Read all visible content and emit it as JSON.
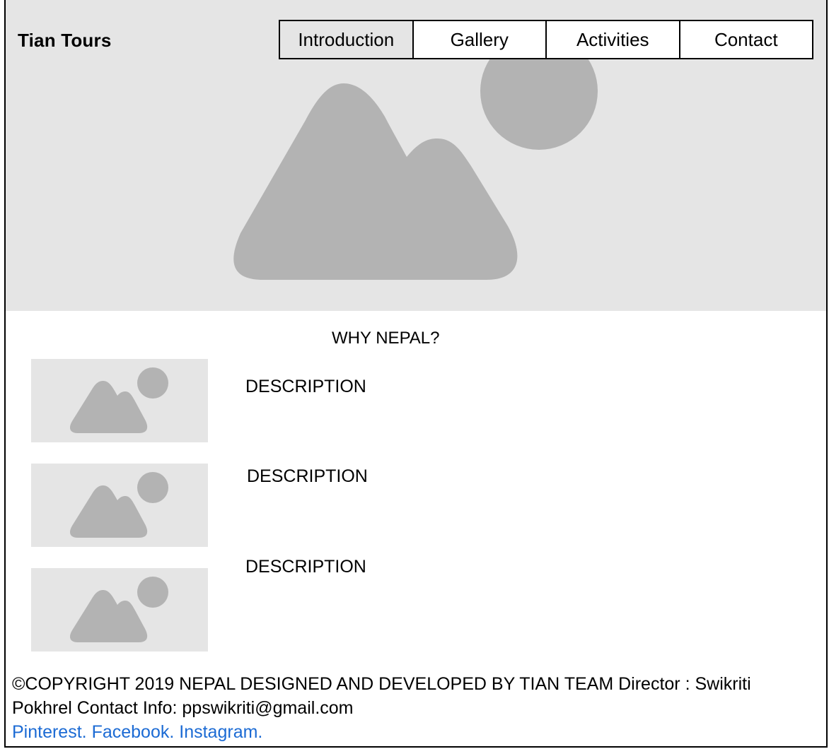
{
  "header": {
    "brand": "Tian Tours",
    "nav": [
      {
        "label": "Introduction",
        "active": true
      },
      {
        "label": "Gallery",
        "active": false
      },
      {
        "label": "Activities",
        "active": false
      },
      {
        "label": "Contact",
        "active": false
      }
    ],
    "hero_image_icon": "image-placeholder-icon"
  },
  "main": {
    "section_title": "WHY NEPAL?",
    "features": [
      {
        "description": "DESCRIPTION",
        "image_icon": "image-placeholder-icon"
      },
      {
        "description": "DESCRIPTION",
        "image_icon": "image-placeholder-icon"
      },
      {
        "description": "DESCRIPTION",
        "image_icon": "image-placeholder-icon"
      }
    ]
  },
  "footer": {
    "copyright": "©COPYRIGHT 2019 NEPAL DESIGNED AND DEVELOPED BY TIAN TEAM Director : Swikriti Pokhrel Contact Info: ppswikriti@gmail.com",
    "links": [
      "Pinterest.",
      "Facebook.",
      "Instagram."
    ]
  },
  "colors": {
    "placeholder_bg": "#e5e5e5",
    "placeholder_shape": "#b3b3b3",
    "link": "#1c6bd4",
    "border": "#000000"
  }
}
